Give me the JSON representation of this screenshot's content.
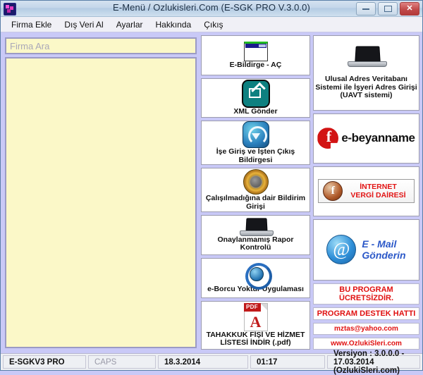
{
  "window": {
    "title": "E-Menü / Ozlukisleri.Com  (E-SGK PRO V.3.0.0)",
    "system_icon": "app-logo-icon",
    "minimize_label": "minimize-icon",
    "maximize_label": "maximize-icon",
    "close_label": "✕"
  },
  "menu": {
    "items": [
      {
        "label": "Firma Ekle"
      },
      {
        "label": "Dış Veri Al"
      },
      {
        "label": "Ayarlar"
      },
      {
        "label": "Hakkında"
      },
      {
        "label": "Çıkış"
      }
    ]
  },
  "search": {
    "placeholder": "Firma Ara",
    "value": ""
  },
  "company_list": {
    "items": []
  },
  "middle_buttons": [
    {
      "id": "e-bildirge-ac",
      "icon": "window-icon",
      "label": "E-Bildirge - AÇ"
    },
    {
      "id": "xml-gonder",
      "icon": "xml-export-icon",
      "label": "XML Gönder"
    },
    {
      "id": "ise-giris-isten-cikis",
      "icon": "circular-arrow-icon",
      "label": "İşe Giriş ve İşten Çıkış Bildirgesi"
    },
    {
      "id": "calismadigina-dair-bildirim",
      "icon": "speaker-icon",
      "label": "Çalışılmadığına dair Bildirim Girişi"
    },
    {
      "id": "onaylanmamis-rapor-kontrolu",
      "icon": "laptop-icon",
      "label": "Onaylanmamış Rapor Kontrolü"
    },
    {
      "id": "e-borcu-yoktur",
      "icon": "globe-arrows-icon",
      "label": "e-Borcu Yoktur Uygulaması"
    },
    {
      "id": "tahakkuk-fisi-indir",
      "icon": "pdf-icon",
      "label": "TAHAKKUK FİŞİ VE HİZMET LİSTESİ İNDİR (.pdf)"
    }
  ],
  "right_buttons": {
    "uavt": {
      "icon": "laptop-icon",
      "label": "Ulusal Adres Veritabanı Sistemi ile İşyeri Adres Girişi (UAVT sistemi)"
    },
    "ebeyanname": {
      "logo_glyph": "f",
      "label": "e-beyanname"
    },
    "internet_vergi": {
      "logo_glyph": "f",
      "line1": "İNTERNET",
      "line2": "VERGİ DAİRESİ"
    },
    "email": {
      "icon": "at-sign-icon",
      "line1": "E - Mail",
      "line2": "Gönderin"
    }
  },
  "support": {
    "line1": "BU PROGRAM ÜCRETSİZDİR.",
    "line2": "PROGRAM DESTEK HATTI",
    "line3": "mztas@yahoo.com",
    "line4": "www.OzlukiSleri.com"
  },
  "statusbar": {
    "app": "E-SGKV3 PRO",
    "caps": "CAPS",
    "date": "18.3.2014",
    "time": "01:17",
    "version": "Versiyon : 3.0.0.0 - 17.03.2014 (OzlukiSleri.com)"
  },
  "colors": {
    "background": "#c9c9f7",
    "field": "#fbf8c8",
    "accent_red": "#e01010",
    "teal": "#0d8080"
  }
}
